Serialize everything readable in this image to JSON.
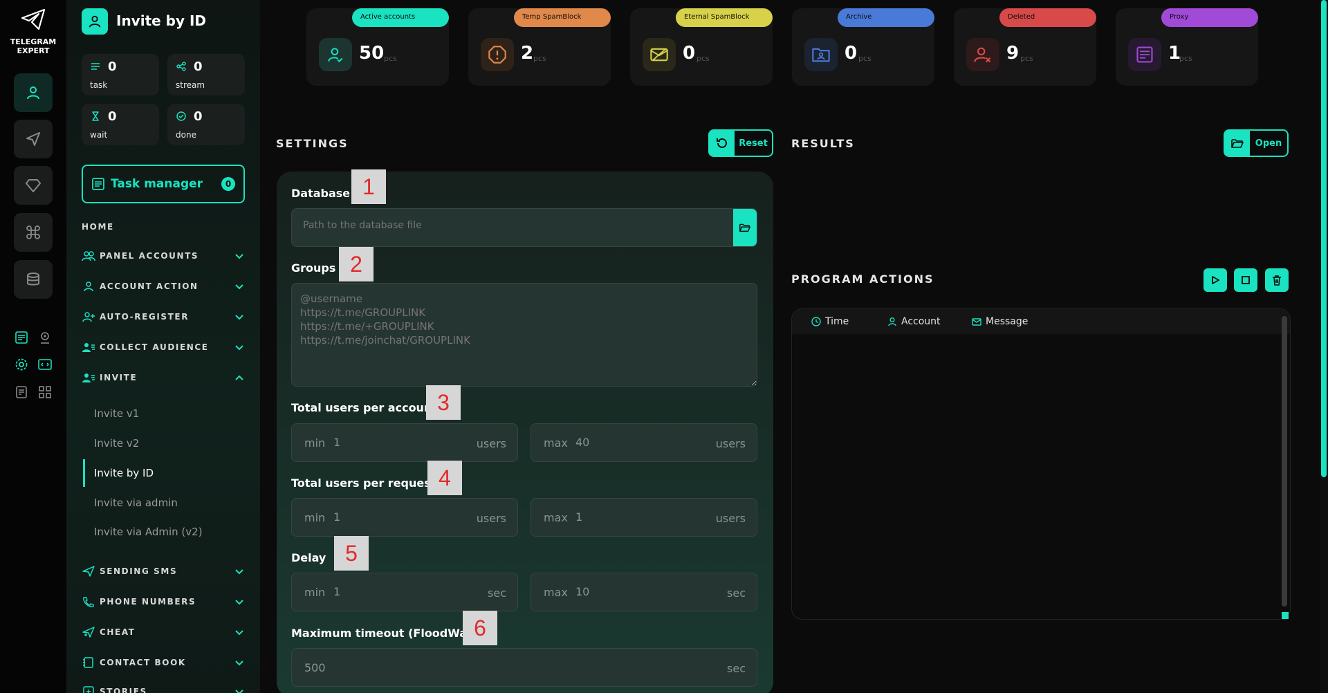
{
  "brand": {
    "line1": "TELEGRAM",
    "line2": "EXPERT"
  },
  "colors": {
    "accent": "#19e3c0",
    "active": "#1de9b6",
    "temp": "#e0894a",
    "eternal": "#d8d24a",
    "archive": "#4a7ad8",
    "deleted": "#d84a4a",
    "proxy": "#a24ad8"
  },
  "rail": {
    "icons": [
      "user-icon",
      "send-icon",
      "diamond-icon",
      "command-icon",
      "database-icon",
      "list-icon",
      "location-icon",
      "settings-icon",
      "code-icon",
      "document-icon",
      "apps-icon"
    ]
  },
  "header": {
    "title": "Invite by ID"
  },
  "stats": [
    {
      "value": "0",
      "label": "task"
    },
    {
      "value": "0",
      "label": "stream"
    },
    {
      "value": "0",
      "label": "wait"
    },
    {
      "value": "0",
      "label": "done"
    }
  ],
  "task_manager": {
    "label": "Task manager",
    "count": "0"
  },
  "nav": {
    "home": "HOME",
    "sections": [
      {
        "label": "PANEL ACCOUNTS"
      },
      {
        "label": "ACCOUNT ACTION"
      },
      {
        "label": "AUTO-REGISTER"
      },
      {
        "label": "COLLECT AUDIENCE"
      },
      {
        "label": "INVITE"
      }
    ],
    "invite_items": [
      "Invite v1",
      "Invite v2",
      "Invite by ID",
      "Invite via admin",
      "Invite via Admin (v2)"
    ],
    "sections_after": [
      {
        "label": "SENDING SMS"
      },
      {
        "label": "PHONE NUMBERS"
      },
      {
        "label": "CHEAT"
      },
      {
        "label": "CONTACT BOOK"
      },
      {
        "label": "STORIES"
      }
    ]
  },
  "accounts": [
    {
      "tag": "Active accounts",
      "value": "50",
      "unit": "pcs"
    },
    {
      "tag": "Temp SpamBlock",
      "value": "2",
      "unit": "pcs"
    },
    {
      "tag": "Eternal SpamBlock",
      "value": "0",
      "unit": "pcs"
    },
    {
      "tag": "Archive",
      "value": "0",
      "unit": "pcs"
    },
    {
      "tag": "Deleted",
      "value": "9",
      "unit": "pcs"
    },
    {
      "tag": "Proxy",
      "value": "1",
      "unit": "pcs"
    }
  ],
  "settings": {
    "title": "SETTINGS",
    "reset": "Reset",
    "database": {
      "label": "Database",
      "placeholder": "Path to the database file",
      "marker": "1"
    },
    "groups": {
      "label": "Groups",
      "placeholder": "@username\nhttps://t.me/GROUPLINK\nhttps://t.me/+GROUPLINK\nhttps://t.me/joinchat/GROUPLINK",
      "marker": "2"
    },
    "per_account": {
      "label": "Total users per account",
      "marker": "3",
      "min_label": "min",
      "min": "1",
      "max_label": "max",
      "max": "40",
      "unit": "users"
    },
    "per_request": {
      "label": "Total users per request",
      "marker": "4",
      "min_label": "min",
      "min": "1",
      "max_label": "max",
      "max": "1",
      "unit": "users"
    },
    "delay": {
      "label": "Delay",
      "marker": "5",
      "min_label": "min",
      "min": "1",
      "max_label": "max",
      "max": "10",
      "unit": "sec"
    },
    "floodwait": {
      "label": "Maximum timeout (FloodWait)",
      "marker": "6",
      "value": "500",
      "unit": "sec"
    }
  },
  "results": {
    "title": "RESULTS",
    "open": "Open"
  },
  "actions": {
    "title": "PROGRAM ACTIONS",
    "columns": [
      "Time",
      "Account",
      "Message"
    ]
  }
}
